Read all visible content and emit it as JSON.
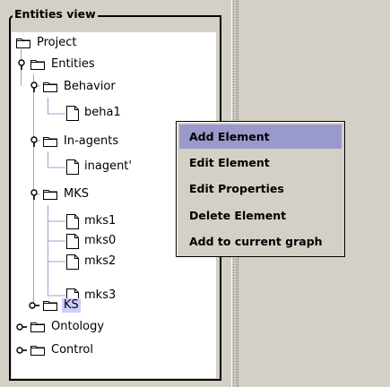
{
  "panel": {
    "title": "Entities view"
  },
  "tree": {
    "project": "Project",
    "entities": "Entities",
    "behavior": "Behavior",
    "beha1": "beha1",
    "in_agents": "In-agents",
    "inagent": "inagent'",
    "mks": "MKS",
    "mks1": "mks1",
    "mks0": "mks0",
    "mks2": "mks2",
    "mks3": "mks3",
    "ks": "KS",
    "ontology": "Ontology",
    "control": "Control"
  },
  "context_menu": {
    "items": [
      "Add Element",
      "Edit Element",
      "Edit Properties",
      "Delete Element",
      "Add to current graph"
    ],
    "highlighted": "Add Element"
  },
  "colors": {
    "background": "#d4d0c8",
    "selection": "#ccccff",
    "menu_highlight": "#9999cc"
  },
  "icons": {
    "expanded": "key-handle-expanded-icon",
    "collapsed": "key-handle-collapsed-icon",
    "folder": "folder-icon",
    "leaf": "document-icon"
  }
}
